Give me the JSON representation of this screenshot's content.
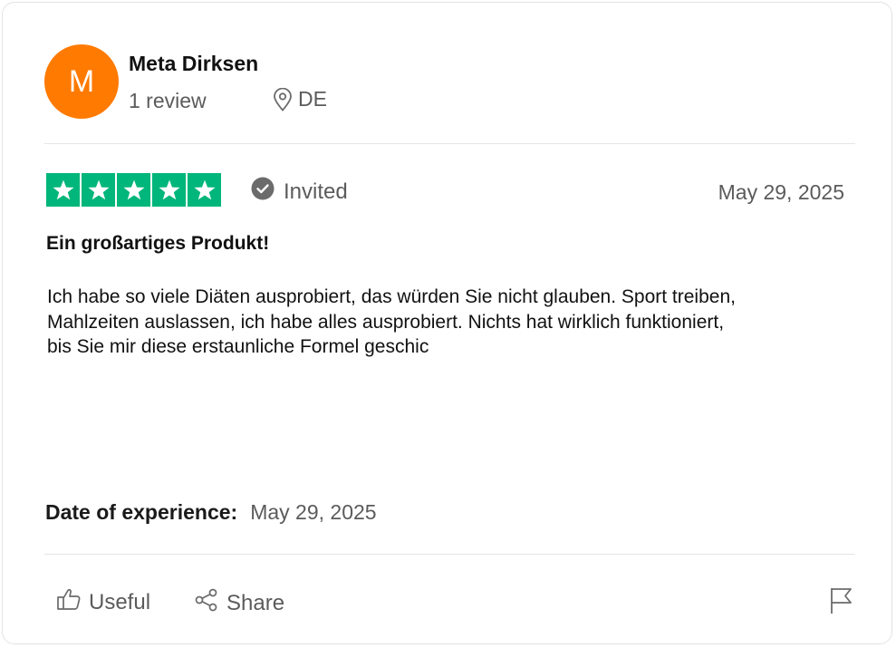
{
  "reviewer": {
    "initial": "M",
    "name": "Meta Dirksen",
    "review_count": "1 review",
    "country": "DE",
    "avatar_color": "#ff7a00"
  },
  "review": {
    "rating": 5,
    "rating_max": 5,
    "star_color": "#00b67a",
    "badge": "Invited",
    "date": "May 29, 2025",
    "title": "Ein großartiges Produkt!",
    "lines": [
      "Ich habe so viele Diäten ausprobiert, das würden Sie nicht glauben. Sport treiben,",
      "Mahlzeiten auslassen, ich habe alles ausprobiert. Nichts hat wirklich funktioniert,",
      "bis Sie mir diese erstaunliche Formel geschic"
    ],
    "experience_label": "Date of experience:",
    "experience_date": "May 29, 2025"
  },
  "actions": {
    "useful_label": "Useful",
    "useful_icon": "thumbs-up-icon",
    "share_label": "Share",
    "share_icon": "share-icon",
    "report_icon": "flag-icon"
  }
}
